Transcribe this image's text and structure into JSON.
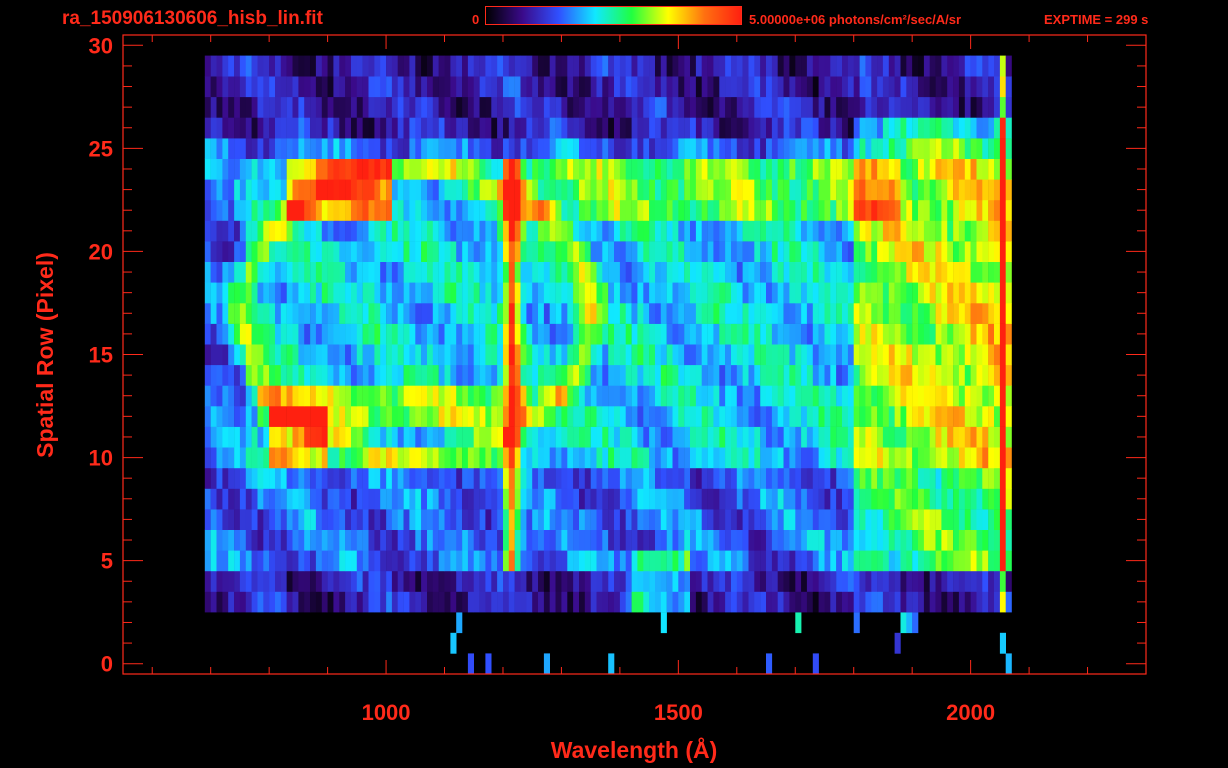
{
  "header": {
    "file_title": "ra_150906130606_hisb_lin.fit",
    "colorbar_min": "0",
    "colorbar_max": "5.00000e+06 photons/cm²/sec/A/sr",
    "exptime": "EXPTIME = 299 s"
  },
  "colors": {
    "axis": "#ff2a1a",
    "background": "#000000",
    "colormap": [
      "#000000",
      "#3a0a8a",
      "#3050ff",
      "#10e8ff",
      "#20ff40",
      "#ffff00",
      "#ff7010",
      "#ff2010"
    ]
  },
  "chart_data": {
    "type": "heatmap",
    "title": "ra_150906130606_hisb_lin.fit",
    "xlabel": "Wavelength (Å)",
    "ylabel": "Spatial Row (Pixel)",
    "xlim": [
      550,
      2300
    ],
    "ylim": [
      -0.5,
      30.5
    ],
    "x_ticks": [
      "1000",
      "1500",
      "2000"
    ],
    "y_ticks": [
      "0",
      "5",
      "10",
      "15",
      "20",
      "25",
      "30"
    ],
    "color_scale": {
      "min": 0,
      "max": 5000000,
      "unit": "photons/cm²/sec/A/sr"
    },
    "grid": false,
    "features": [
      {
        "wavelength": 1216,
        "rows": [
          5,
          24
        ],
        "intensity": "high"
      },
      {
        "wavelength": 840,
        "rows": [
          10,
          24
        ],
        "intensity": "high"
      },
      {
        "wavelength": 2060,
        "rows": [
          1,
          30
        ],
        "intensity": "high"
      }
    ]
  }
}
